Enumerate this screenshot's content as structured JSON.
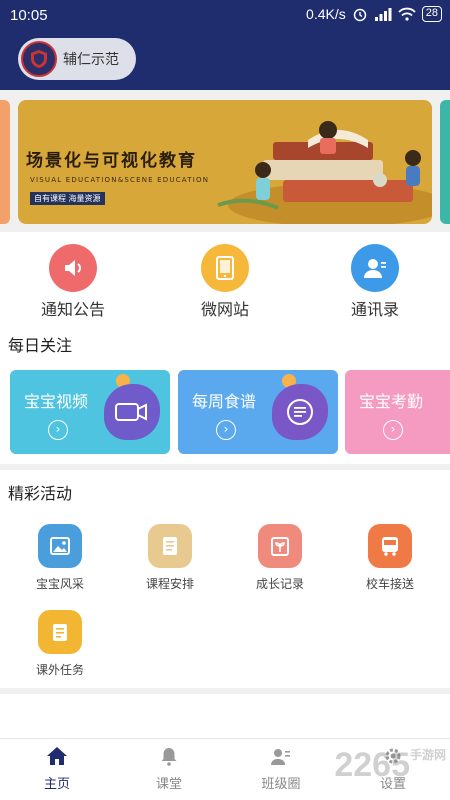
{
  "status_bar": {
    "time": "10:05",
    "speed": "0.4K/s",
    "battery": "28"
  },
  "header": {
    "school_name": "辅仁示范"
  },
  "banner": {
    "title": "场景化与可视化教育",
    "subtitle": "VISUAL EDUCATION&SCENE EDUCATION",
    "tag": "自有课程 海量资源"
  },
  "shortcuts": [
    {
      "label": "通知公告",
      "icon": "speaker-icon",
      "color": "#ef6b6b"
    },
    {
      "label": "微网站",
      "icon": "tablet-icon",
      "color": "#f5b83a"
    },
    {
      "label": "通讯录",
      "icon": "contact-icon",
      "color": "#3d9ae8"
    }
  ],
  "daily": {
    "title": "每日关注",
    "cards": [
      {
        "label": "宝宝视频",
        "icon": "video-camera-icon",
        "color": "#4fc4e0"
      },
      {
        "label": "每周食谱",
        "icon": "recipe-icon",
        "color": "#5aa9ef"
      },
      {
        "label": "宝宝考勤",
        "icon": "attendance-icon",
        "color": "#f59bc1"
      }
    ]
  },
  "activities": {
    "title": "精彩活动",
    "items": [
      {
        "label": "宝宝风采",
        "icon": "photo-icon",
        "color": "#4a9edb"
      },
      {
        "label": "课程安排",
        "icon": "schedule-icon",
        "color": "#e8c98f"
      },
      {
        "label": "成长记录",
        "icon": "growth-icon",
        "color": "#ef8a7d"
      },
      {
        "label": "校车接送",
        "icon": "bus-icon",
        "color": "#ef7a45"
      },
      {
        "label": "课外任务",
        "icon": "task-icon",
        "color": "#f2b632"
      }
    ]
  },
  "tabs": [
    {
      "label": "主页",
      "icon": "home-icon",
      "active": true
    },
    {
      "label": "课堂",
      "icon": "bell-icon",
      "active": false
    },
    {
      "label": "班级圈",
      "icon": "circle-icon",
      "active": false
    },
    {
      "label": "设置",
      "icon": "gear-icon",
      "active": false
    }
  ],
  "watermark": {
    "number": "2265",
    "text": "手游网"
  },
  "colors": {
    "header": "#1f2d6e",
    "accent": "#1f2d6e"
  }
}
